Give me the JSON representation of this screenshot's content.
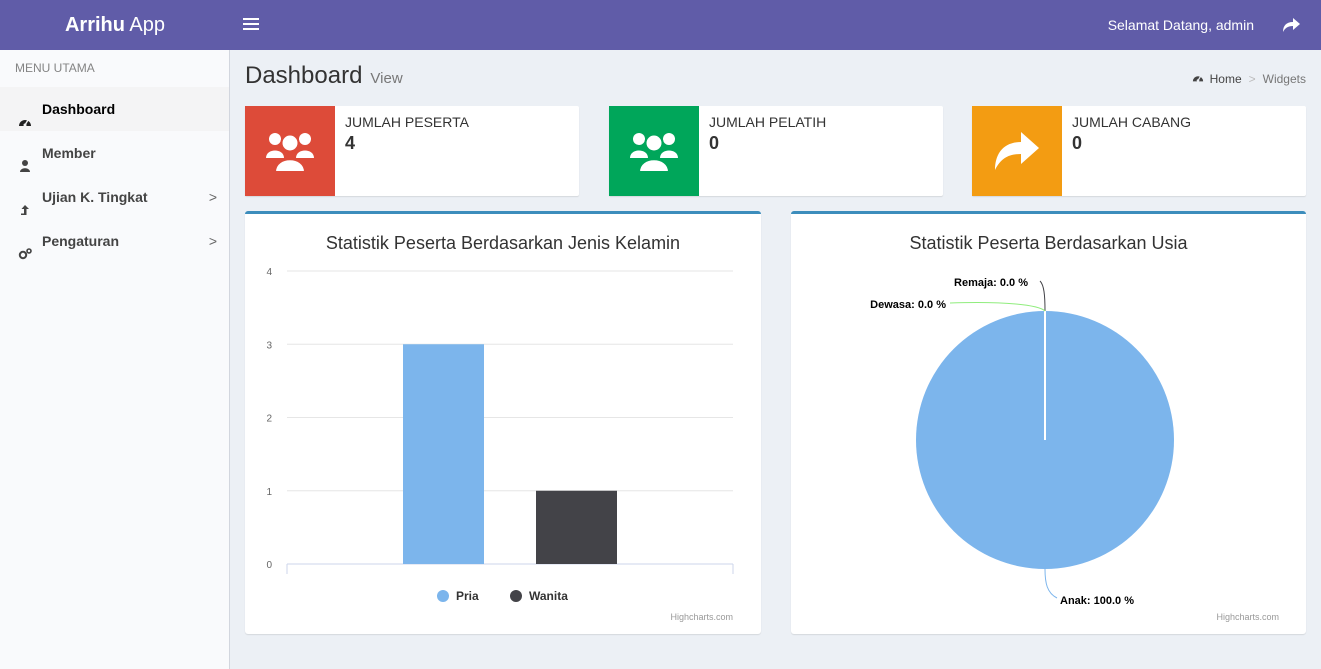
{
  "app": {
    "brand_bold": "Arrihu",
    "brand_rest": " App"
  },
  "header": {
    "welcome": "Selamat Datang, admin"
  },
  "sidebar": {
    "header": "MENU UTAMA",
    "items": [
      {
        "label": "Dashboard",
        "icon": "dashboard-icon"
      },
      {
        "label": "Member",
        "icon": "user-icon"
      },
      {
        "label": "Ujian K. Tingkat",
        "icon": "level-up-icon",
        "chevron": ">"
      },
      {
        "label": "Pengaturan",
        "icon": "gears-icon",
        "chevron": ">"
      }
    ]
  },
  "page": {
    "title": "Dashboard",
    "subtitle": "View"
  },
  "breadcrumb": {
    "home": "Home",
    "sep": ">",
    "current": "Widgets"
  },
  "widgets": [
    {
      "label": "JUMLAH PESERTA",
      "value": "4",
      "color": "#dd4b39",
      "icon": "users-icon"
    },
    {
      "label": "JUMLAH PELATIH",
      "value": "0",
      "color": "#00a65a",
      "icon": "users-icon"
    },
    {
      "label": "JUMLAH CABANG",
      "value": "0",
      "color": "#f39c12",
      "icon": "share-icon"
    }
  ],
  "colors": {
    "accent": "#605ca8",
    "box_top": "#3c8dbc"
  },
  "chart_data": [
    {
      "type": "bar",
      "title": "Statistik Peserta Berdasarkan Jenis Kelamin",
      "yticks": [
        "0",
        "1",
        "2",
        "3",
        "4"
      ],
      "ylim": [
        0,
        4
      ],
      "series": [
        {
          "name": "Pria",
          "value": 3,
          "color": "#7cb5ec"
        },
        {
          "name": "Wanita",
          "value": 1,
          "color": "#434348"
        }
      ],
      "legend": "bottom-center",
      "credits": "Highcharts.com"
    },
    {
      "type": "pie",
      "title": "Statistik Peserta Berdasarkan Usia",
      "slices": [
        {
          "name": "Anak",
          "value": 100.0,
          "label": "Anak: 100.0 %",
          "color": "#7cb5ec"
        },
        {
          "name": "Remaja",
          "value": 0.0,
          "label": "Remaja: 0.0 %",
          "color": "#434348"
        },
        {
          "name": "Dewasa",
          "value": 0.0,
          "label": "Dewasa: 0.0 %",
          "color": "#90ed7d"
        }
      ],
      "credits": "Highcharts.com"
    }
  ]
}
